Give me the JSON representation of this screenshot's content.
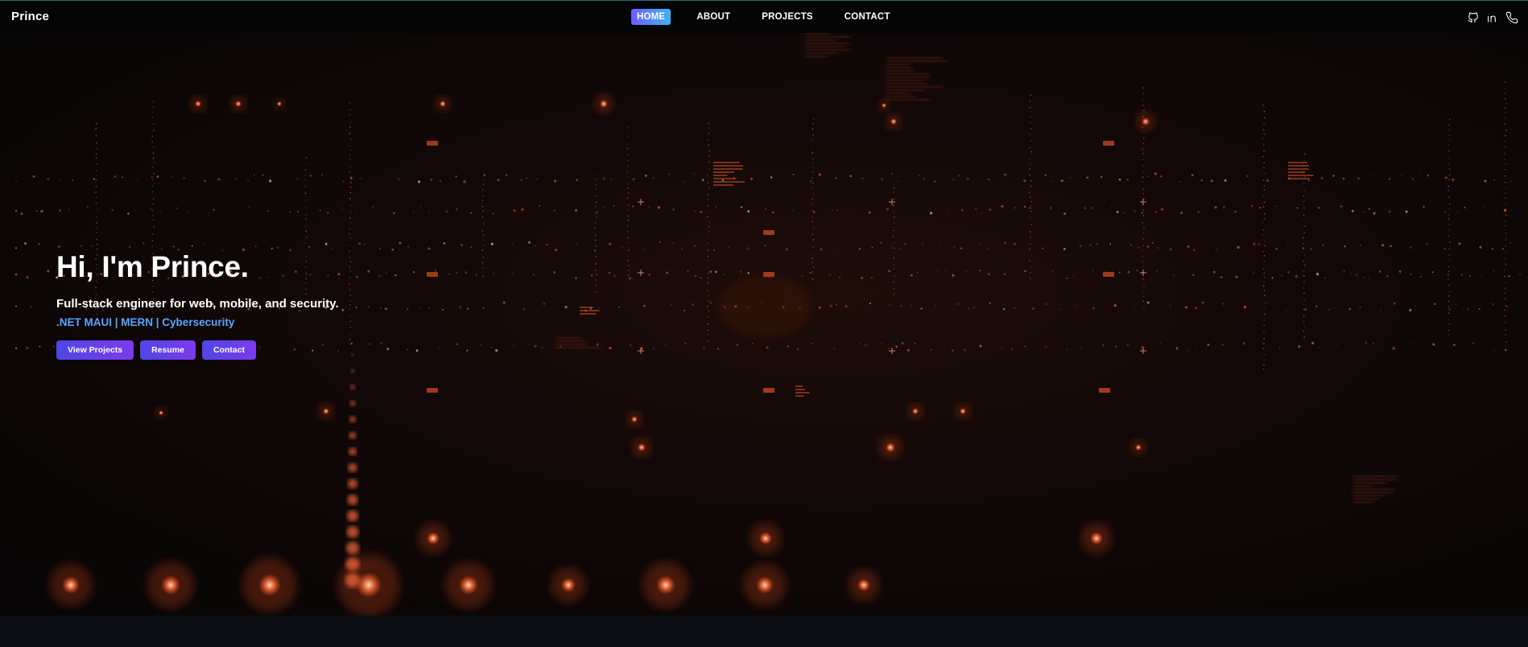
{
  "nav": {
    "brand": "Prince",
    "links": [
      {
        "label": "HOME",
        "active": true
      },
      {
        "label": "ABOUT",
        "active": false
      },
      {
        "label": "PROJECTS",
        "active": false
      },
      {
        "label": "CONTACT",
        "active": false
      }
    ],
    "icons": [
      "github-icon",
      "linkedin-icon",
      "phone-icon"
    ]
  },
  "hero": {
    "title": "Hi, I'm Prince.",
    "subtitle": "Full-stack engineer for web, mobile, and security.",
    "tags": ".NET MAUI | MERN | Cybersecurity",
    "buttons": {
      "view_projects": "View Projects",
      "resume": "Resume",
      "contact": "Contact"
    }
  },
  "colors": {
    "accent_blue": "#58a6ff",
    "button_gradient_start": "#4f46e5",
    "button_gradient_end": "#7c3aed",
    "glow": "#ff6a3a",
    "background": "#070506"
  }
}
